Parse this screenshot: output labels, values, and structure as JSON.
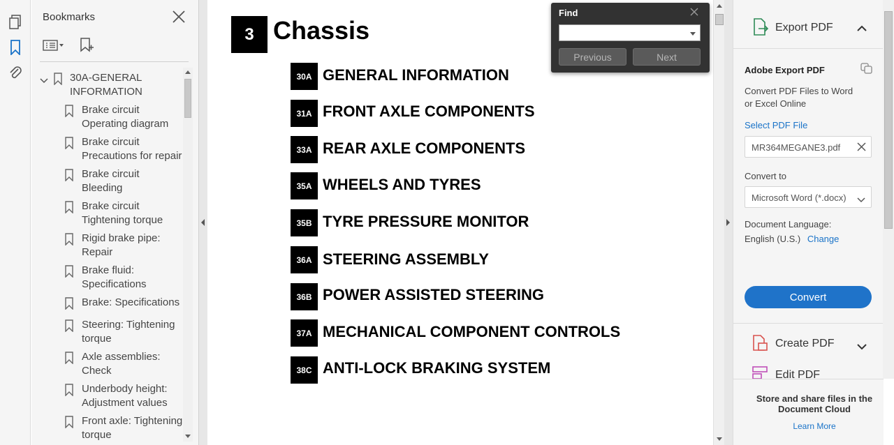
{
  "left_toolbar": {
    "icons": [
      "page-thumbnails-icon",
      "bookmark-icon",
      "attachment-icon"
    ]
  },
  "bookmarks": {
    "title": "Bookmarks",
    "items": [
      {
        "label": "30A-GENERAL\nINFORMATION"
      },
      {
        "label": "Brake circuit\nOperating diagram"
      },
      {
        "label": "Brake circuit\nPrecautions for repair"
      },
      {
        "label": "Brake circuit\nBleeding"
      },
      {
        "label": "Brake circuit\nTightening torque"
      },
      {
        "label": "Rigid brake pipe:\nRepair"
      },
      {
        "label": "Brake fluid:\nSpecifications"
      },
      {
        "label": "Brake: Specifications"
      },
      {
        "label": "Steering: Tightening\ntorque"
      },
      {
        "label": "Axle assemblies:\nCheck"
      },
      {
        "label": "Underbody height:\nAdjustment values"
      },
      {
        "label": "Front axle: Tightening\ntorque"
      }
    ]
  },
  "document": {
    "chapter_number": "3",
    "chapter_title": "Chassis",
    "sections": [
      {
        "code": "30A",
        "name": "GENERAL INFORMATION"
      },
      {
        "code": "31A",
        "name": "FRONT AXLE COMPONENTS"
      },
      {
        "code": "33A",
        "name": "REAR AXLE COMPONENTS"
      },
      {
        "code": "35A",
        "name": "WHEELS AND TYRES"
      },
      {
        "code": "35B",
        "name": "TYRE PRESSURE MONITOR"
      },
      {
        "code": "36A",
        "name": "STEERING ASSEMBLY"
      },
      {
        "code": "36B",
        "name": "POWER ASSISTED STEERING"
      },
      {
        "code": "37A",
        "name": "MECHANICAL COMPONENT CONTROLS"
      },
      {
        "code": "38C",
        "name": "ANTI-LOCK BRAKING SYSTEM"
      }
    ]
  },
  "find": {
    "title": "Find",
    "input_value": "",
    "previous_label": "Previous",
    "next_label": "Next"
  },
  "right_panel": {
    "export_pdf_label": "Export PDF",
    "adobe_export_title": "Adobe Export PDF",
    "description": "Convert PDF Files to Word\nor Excel Online",
    "select_file_label": "Select PDF File",
    "file_name": "MR364MEGANE3.pdf",
    "convert_to_label": "Convert to",
    "convert_format": "Microsoft Word (*.docx)",
    "doc_language_label": "Document Language:",
    "doc_language_value": "English (U.S.)",
    "change_label": "Change",
    "convert_button": "Convert",
    "create_pdf_label": "Create PDF",
    "edit_pdf_label": "Edit PDF",
    "store_text": "Store and share files in the Document Cloud",
    "learn_more": "Learn More"
  },
  "colors": {
    "accent_blue": "#1f73c9",
    "link_blue": "#1a73c8",
    "find_dialog_bg": "#323232"
  }
}
